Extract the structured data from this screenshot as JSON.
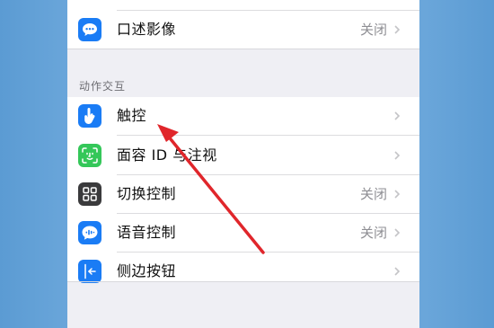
{
  "audio_description": {
    "label": "口述影像",
    "value": "关闭",
    "icon": "speech-bubble-icon",
    "color": "#1a7cf5"
  },
  "section": {
    "header": "动作交互"
  },
  "rows": [
    {
      "label": "触控",
      "value": "",
      "icon": "hand-pointer-icon",
      "color": "#1a7cf5"
    },
    {
      "label": "面容 ID 与注视",
      "value": "",
      "icon": "face-id-icon",
      "color": "#34c759"
    },
    {
      "label": "切换控制",
      "value": "关闭",
      "icon": "grid-icon",
      "color": "#3a3a3c"
    },
    {
      "label": "语音控制",
      "value": "关闭",
      "icon": "voice-control-icon",
      "color": "#1a7cf5"
    },
    {
      "label": "侧边按钮",
      "value": "",
      "icon": "side-button-icon",
      "color": "#1a7cf5"
    }
  ],
  "annotation": {
    "arrow_color": "#e0262b"
  }
}
